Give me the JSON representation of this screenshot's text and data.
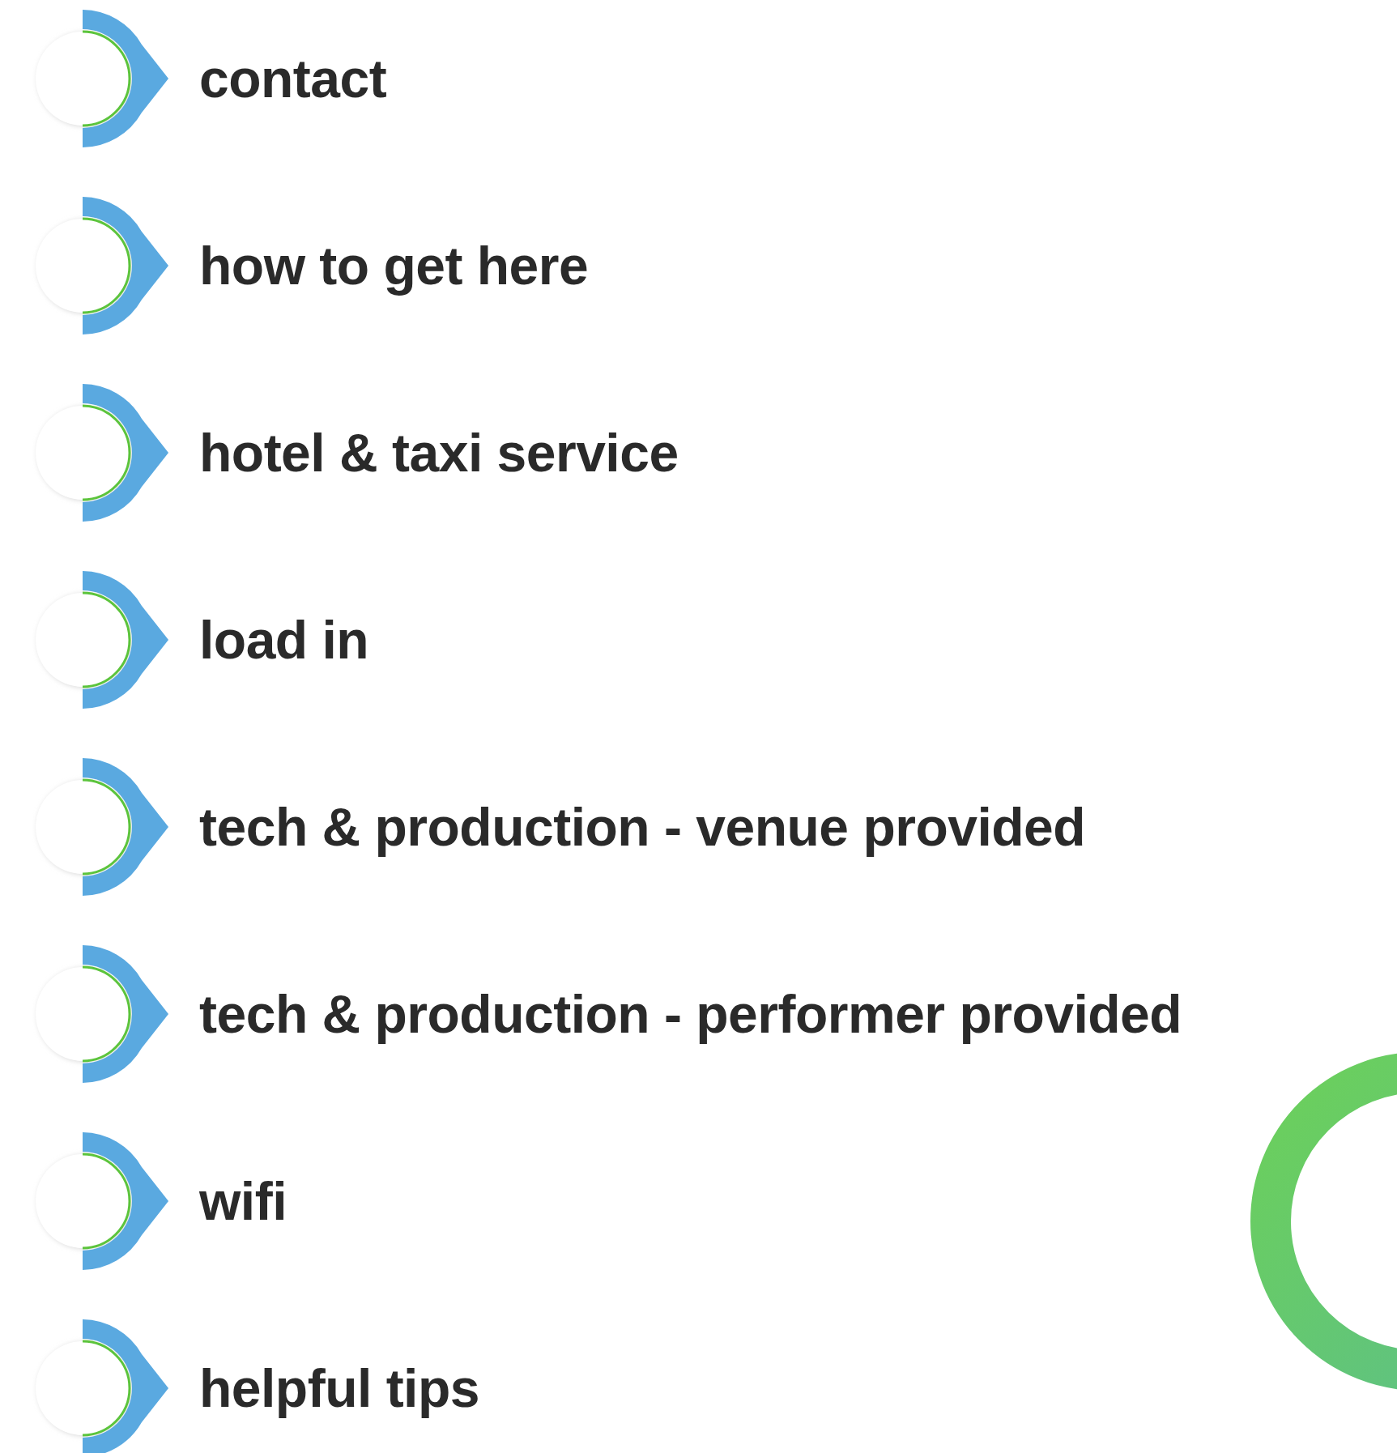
{
  "menu": {
    "items": [
      {
        "label": "contact"
      },
      {
        "label": "how to get here"
      },
      {
        "label": "hotel & taxi service"
      },
      {
        "label": "load in"
      },
      {
        "label": "tech & production - venue provided"
      },
      {
        "label": "tech & production - performer provided"
      },
      {
        "label": "wifi"
      },
      {
        "label": "helpful tips"
      }
    ]
  }
}
